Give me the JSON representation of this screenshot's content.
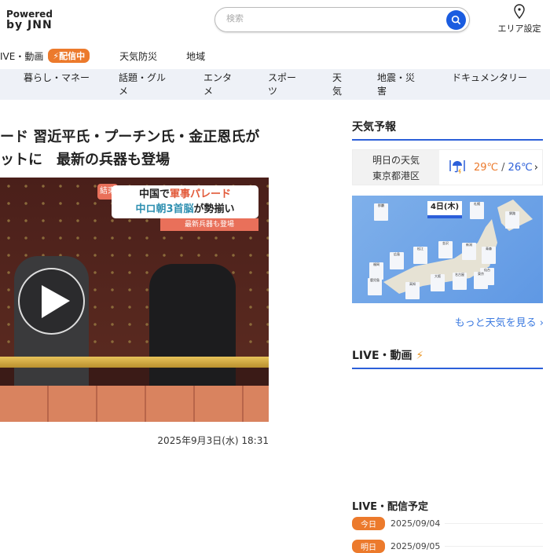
{
  "header": {
    "logo_line1": "Powered",
    "logo_line2": "by JNN",
    "search_placeholder": "検索",
    "area_label": "エリア設定"
  },
  "nav": {
    "items": [
      {
        "label": "IVE・動画",
        "badge": "配信中"
      },
      {
        "label": "天気防災"
      },
      {
        "label": "地域"
      }
    ]
  },
  "categories": [
    "暮らし・マネー",
    "話題・グルメ",
    "エンタメ",
    "スポーツ",
    "天気",
    "地震・災害",
    "ドキュメンタリー"
  ],
  "article": {
    "title_line1": "ード 習近平氏・プーチン氏・金正恩氏が",
    "title_line2": "ットに　最新の兵器も登場",
    "date": "2025年9月3日(水) 18:31",
    "video_caption": {
      "tag": "結束",
      "line1a": "中国で",
      "line1b": "軍事パレード",
      "line2a": "中ロ朝3首脳",
      "line2b": "が勢揃い",
      "sub": "最新兵器も登場"
    }
  },
  "weather": {
    "heading": "天気予報",
    "card_label1": "明日の天気",
    "card_label2": "東京都港区",
    "icon": "rain-umbrella-icon",
    "high": "29℃",
    "sep": "/",
    "low": "26℃",
    "map_date": "4日(木)",
    "cities": [
      "那覇",
      "札幌",
      "釧路",
      "青森",
      "新潟",
      "金沢",
      "松江",
      "広島",
      "福岡",
      "仙台",
      "鹿児島",
      "高知",
      "大阪",
      "名古屋",
      "東京"
    ],
    "more_link": "もっと天気を見る ›"
  },
  "live": {
    "heading": "LIVE・動画"
  },
  "schedule": {
    "heading": "LIVE・配信予定",
    "rows": [
      {
        "tag": "今日",
        "date": "2025/09/04"
      },
      {
        "tag": "明日",
        "date": "2025/09/05"
      }
    ]
  },
  "colors": {
    "accent": "#2c5fd9",
    "orange": "#ec7a2c",
    "search_button": "#1a5ce0"
  }
}
